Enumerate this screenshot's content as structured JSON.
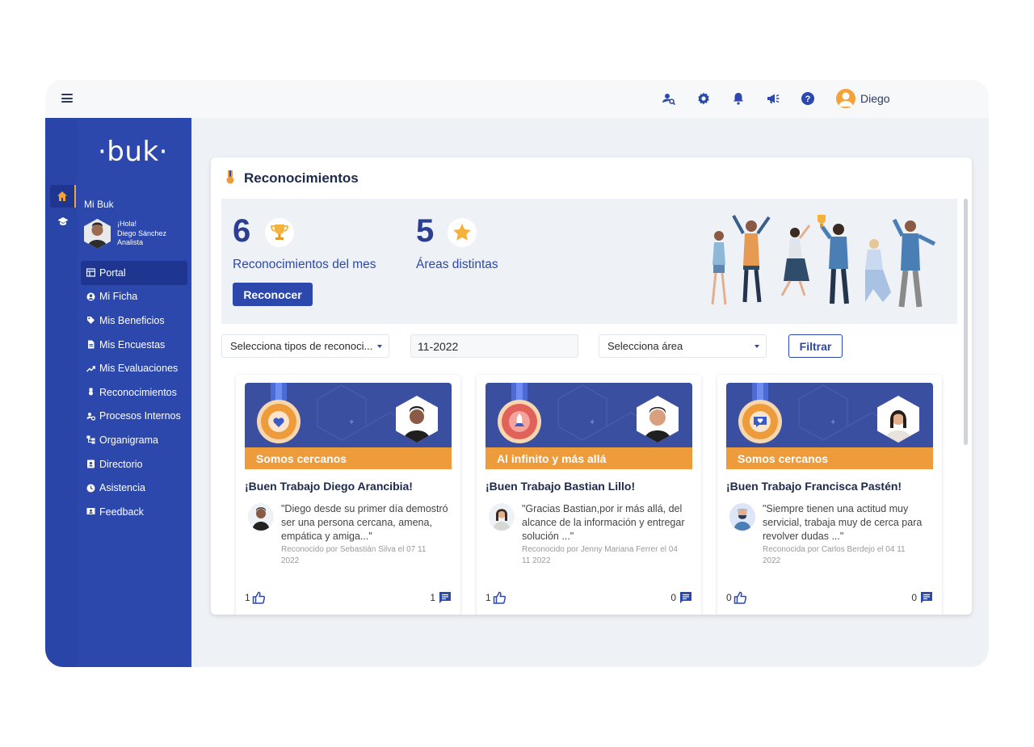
{
  "topbar": {
    "user_name": "Diego",
    "icons": [
      "people-search-icon",
      "gear-icon",
      "bell-icon",
      "megaphone-icon",
      "help-icon",
      "user-avatar-icon"
    ]
  },
  "sidebar": {
    "logo": "·buk·",
    "section_title": "Mi Buk",
    "profile": {
      "greeting": "¡Hola!",
      "name": "Diego Sánchez",
      "role": "Analista"
    },
    "items": [
      {
        "label": "Portal",
        "icon": "portal-icon"
      },
      {
        "label": "Mi Ficha",
        "icon": "user-circle-icon"
      },
      {
        "label": "Mis Beneficios",
        "icon": "tag-icon"
      },
      {
        "label": "Mis Encuestas",
        "icon": "document-icon"
      },
      {
        "label": "Mis Evaluaciones",
        "icon": "trending-icon"
      },
      {
        "label": "Reconocimientos",
        "icon": "medal-icon"
      },
      {
        "label": "Procesos Internos",
        "icon": "users-cog-icon"
      },
      {
        "label": "Organigrama",
        "icon": "org-chart-icon"
      },
      {
        "label": "Directorio",
        "icon": "contact-book-icon"
      },
      {
        "label": "Asistencia",
        "icon": "clock-icon"
      },
      {
        "label": "Feedback",
        "icon": "feedback-icon"
      }
    ]
  },
  "main": {
    "title": "Reconocimientos",
    "stats": [
      {
        "value": "6",
        "label": "Reconocimientos del mes",
        "icon": "trophy-icon"
      },
      {
        "value": "5",
        "label": "Áreas distintas",
        "icon": "star-icon"
      }
    ],
    "primary_button": "Reconocer",
    "filters": {
      "type_select": "Selecciona tipos de reconoci...",
      "date_input": "11-2022",
      "area_select": "Selecciona área",
      "filter_button": "Filtrar"
    },
    "cards": [
      {
        "category": "Somos cercanos",
        "title": "¡Buen Trabajo Diego Arancibia!",
        "quote": "\"Diego desde su primer día demostró ser una persona cercana, amena, empática y amiga...\"",
        "by": "Reconocido por Sebastián Silva el 07 11 2022",
        "likes": "1",
        "comments": "1"
      },
      {
        "category": "Al infinito y más allá",
        "title": "¡Buen Trabajo Bastian Lillo!",
        "quote": "\"Gracias Bastian,por ir más allá, del alcance de la información y entregar solución ...\"",
        "by": "Reconocido por Jenny Mariana Ferrer el 04 11 2022",
        "likes": "1",
        "comments": "0"
      },
      {
        "category": "Somos cercanos",
        "title": "¡Buen Trabajo Francisca Pastén!",
        "quote": "\"Siempre tienen una actitud muy servicial, trabaja muy de cerca para revolver dudas ...\"",
        "by": "Reconocida por Carlos Berdejo el 04 11 2022",
        "likes": "0",
        "comments": "0"
      }
    ]
  },
  "colors": {
    "primary": "#2c48ad",
    "accent": "#ee9b3b",
    "banner": "#3b4fa0"
  }
}
